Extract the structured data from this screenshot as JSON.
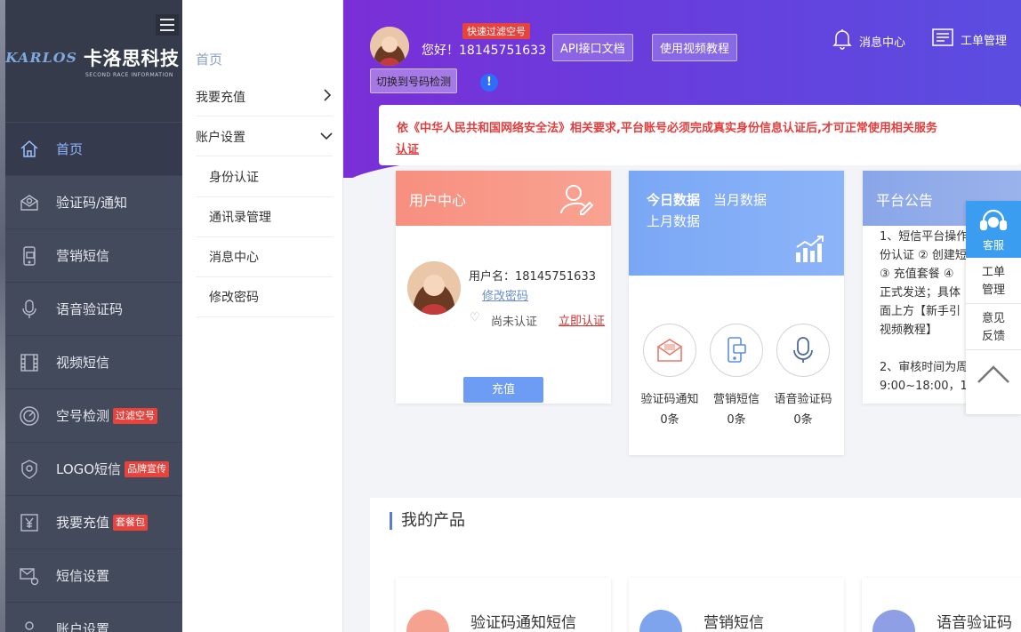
{
  "brand": {
    "logo_en": "KARLOS",
    "logo_cn": "卡洛思科技",
    "logo_sub": "SECOND RACE INFORMATION"
  },
  "sidebar": {
    "items": [
      {
        "label": "首页",
        "icon": "home-icon",
        "badge": ""
      },
      {
        "label": "验证码/通知",
        "icon": "envelope-icon",
        "badge": ""
      },
      {
        "label": "营销短信",
        "icon": "phone-message-icon",
        "badge": ""
      },
      {
        "label": "语音验证码",
        "icon": "microphone-icon",
        "badge": ""
      },
      {
        "label": "视频短信",
        "icon": "film-icon",
        "badge": ""
      },
      {
        "label": "空号检测",
        "icon": "gauge-icon",
        "badge": "过滤空号"
      },
      {
        "label": "LOGO短信",
        "icon": "badge-icon",
        "badge": "品牌宣传"
      },
      {
        "label": "我要充值",
        "icon": "yuan-icon",
        "badge": "套餐包"
      },
      {
        "label": "短信设置",
        "icon": "mail-settings-icon",
        "badge": ""
      },
      {
        "label": "账户设置",
        "icon": "user-icon",
        "badge": ""
      }
    ]
  },
  "submenu": {
    "home": "首页",
    "recharge": "我要充值",
    "account": "账户设置",
    "children": [
      "身份认证",
      "通讯录管理",
      "消息中心",
      "修改密码"
    ]
  },
  "header": {
    "quick_badge": "快速过滤空号",
    "greeting": "您好！18145751633",
    "api_doc": "API接口文档",
    "video_tutorial": "使用视频教程",
    "switch_btn": "切换到号码检测",
    "info_mark": "!",
    "message_center": "消息中心",
    "ticket_mgmt": "工单管理"
  },
  "notice": {
    "text": "依《中华人民共和国网络安全法》相关要求,平台账号必须完成真实身份信息认证后,才可正常使用相关服务",
    "link": "认证"
  },
  "user_card": {
    "title": "用户中心",
    "username": "用户名：18145751633",
    "change_pwd": "修改密码",
    "status": "尚未认证",
    "verify_now": "立即认证",
    "recharge": "充值"
  },
  "data_card": {
    "tab_today": "今日数据",
    "tab_month": "当月数据",
    "tab_last_month": "上月数据",
    "stats": [
      {
        "label": "验证码通知",
        "value": "0条"
      },
      {
        "label": "营销短信",
        "value": "0条"
      },
      {
        "label": "语音验证码",
        "value": "0条"
      }
    ]
  },
  "announcement": {
    "title": "平台公告",
    "lines": [
      "1、短信平台操作",
      "份认证 ② 创建短",
      "③ 充值套餐 ④",
      "正式发送；具体",
      "面上方【新手引",
      "视频教程】",
      "",
      "2、审核时间为周",
      "9:00~18:00，1"
    ]
  },
  "float_panel": {
    "kefu": "客服",
    "ticket_l1": "工单",
    "ticket_l2": "管理",
    "feedback_l1": "意见",
    "feedback_l2": "反馈"
  },
  "products": {
    "title": "我的产品",
    "items": [
      "验证码通知短信",
      "营销短信",
      "语音验证码"
    ]
  },
  "colors": {
    "sidebar_bg": "#434a5c",
    "header_purple": "#7a2fd6",
    "accent_blue": "#6d9cf5",
    "badge_red": "#e8423c",
    "notice_red": "#e33d3d"
  }
}
